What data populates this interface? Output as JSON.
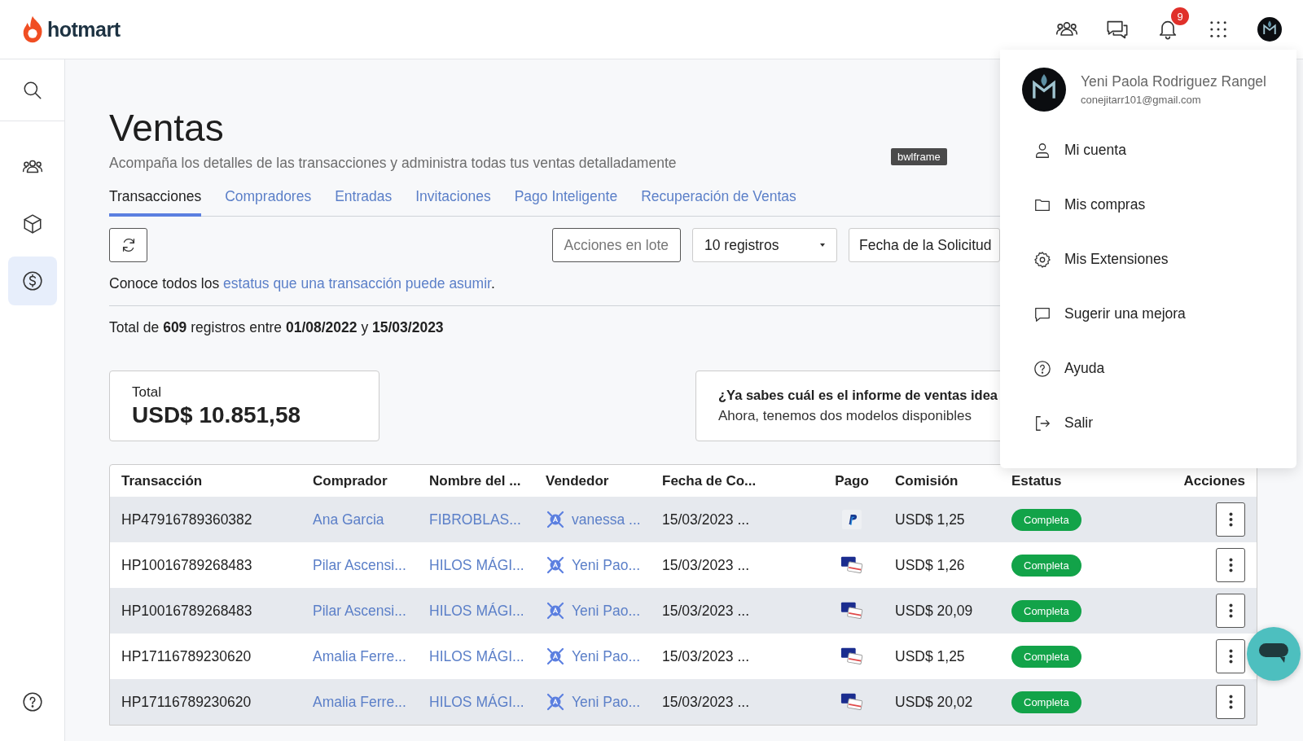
{
  "header": {
    "logo": "hotmart",
    "notifications": "9"
  },
  "sidebar": {
    "items": [
      {
        "kind": "search",
        "selected": false
      },
      {
        "kind": "people",
        "selected": false
      },
      {
        "kind": "box",
        "selected": false
      },
      {
        "kind": "dollar",
        "selected": true
      },
      {
        "kind": "help",
        "selected": false
      }
    ]
  },
  "page": {
    "title": "Ventas",
    "subtitle": "Acompaña los detalles de las transacciones y administra todas tus ventas detalladamente"
  },
  "tooltip": "bwlframe",
  "tabs": [
    {
      "label": "Transacciones",
      "selected": true
    },
    {
      "label": "Compradores",
      "selected": false
    },
    {
      "label": "Entradas",
      "selected": false
    },
    {
      "label": "Invitaciones",
      "selected": false
    },
    {
      "label": "Pago Inteligente",
      "selected": false
    },
    {
      "label": "Recuperación de Ventas",
      "selected": false
    }
  ],
  "toolbar": {
    "bulk_actions": "Acciones en lote",
    "page_size": "10 registros",
    "date_filter": "Fecha de la Solicitud"
  },
  "status_note": {
    "text": "Conoce todos los ",
    "link": "estatus que una transacción puede asumir",
    "end": "."
  },
  "summary": "Total de **609** registros entre **01/08/2022** y **15/03/2023**",
  "total_card": {
    "label": "Total",
    "value": "USD$ 10.851,58"
  },
  "report_card": {
    "title": "¿Ya sabes cuál es el informe de ventas idea",
    "text": "Ahora, tenemos dos modelos disponibles"
  },
  "table": {
    "columns": [
      "Transacción",
      "Comprador",
      "Nombre del ...",
      "Vendedor",
      "Fecha de Co...",
      "Pago",
      "Comisión",
      "Estatus",
      "Acciones"
    ],
    "rows": [
      {
        "transaction": "HP47916789360382",
        "buyer": "Ana Garcia",
        "product": "FIBROBLAS...",
        "seller": "vanessa ...",
        "date": "15/03/2023 ...",
        "payment": {
          "kind": "paypal"
        },
        "commission": "USD$ 1,25",
        "status": "Completa"
      },
      {
        "transaction": "HP10016789268483",
        "buyer": "Pilar Ascensi...",
        "product": "HILOS MÁGI...",
        "seller": "Yeni Pao...",
        "date": "15/03/2023 ...",
        "payment": {
          "kind": "card"
        },
        "commission": "USD$ 1,26",
        "status": "Completa"
      },
      {
        "transaction": "HP10016789268483",
        "buyer": "Pilar Ascensi...",
        "product": "HILOS MÁGI...",
        "seller": "Yeni Pao...",
        "date": "15/03/2023 ...",
        "payment": {
          "kind": "card"
        },
        "commission": "USD$ 20,09",
        "status": "Completa"
      },
      {
        "transaction": "HP17116789230620",
        "buyer": "Amalia Ferre...",
        "product": "HILOS MÁGI...",
        "seller": "Yeni Pao...",
        "date": "15/03/2023 ...",
        "payment": {
          "kind": "card"
        },
        "commission": "USD$ 1,25",
        "status": "Completa"
      },
      {
        "transaction": "HP17116789230620",
        "buyer": "Amalia Ferre...",
        "product": "HILOS MÁGI...",
        "seller": "Yeni Pao...",
        "date": "15/03/2023 ...",
        "payment": {
          "kind": "card"
        },
        "commission": "USD$ 20,02",
        "status": "Completa"
      }
    ]
  },
  "user_menu": {
    "name": "Yeni Paola Rodriguez Rangel",
    "email": "conejitarr101@gmail.com",
    "items": [
      {
        "kind": "account",
        "label": "Mi cuenta"
      },
      {
        "kind": "purchases",
        "label": "Mis compras"
      },
      {
        "kind": "extensions",
        "label": "Mis Extensiones"
      },
      {
        "kind": "feedback",
        "label": "Sugerir una mejora"
      },
      {
        "kind": "help",
        "label": "Ayuda"
      },
      {
        "kind": "logout",
        "label": "Salir"
      }
    ]
  }
}
